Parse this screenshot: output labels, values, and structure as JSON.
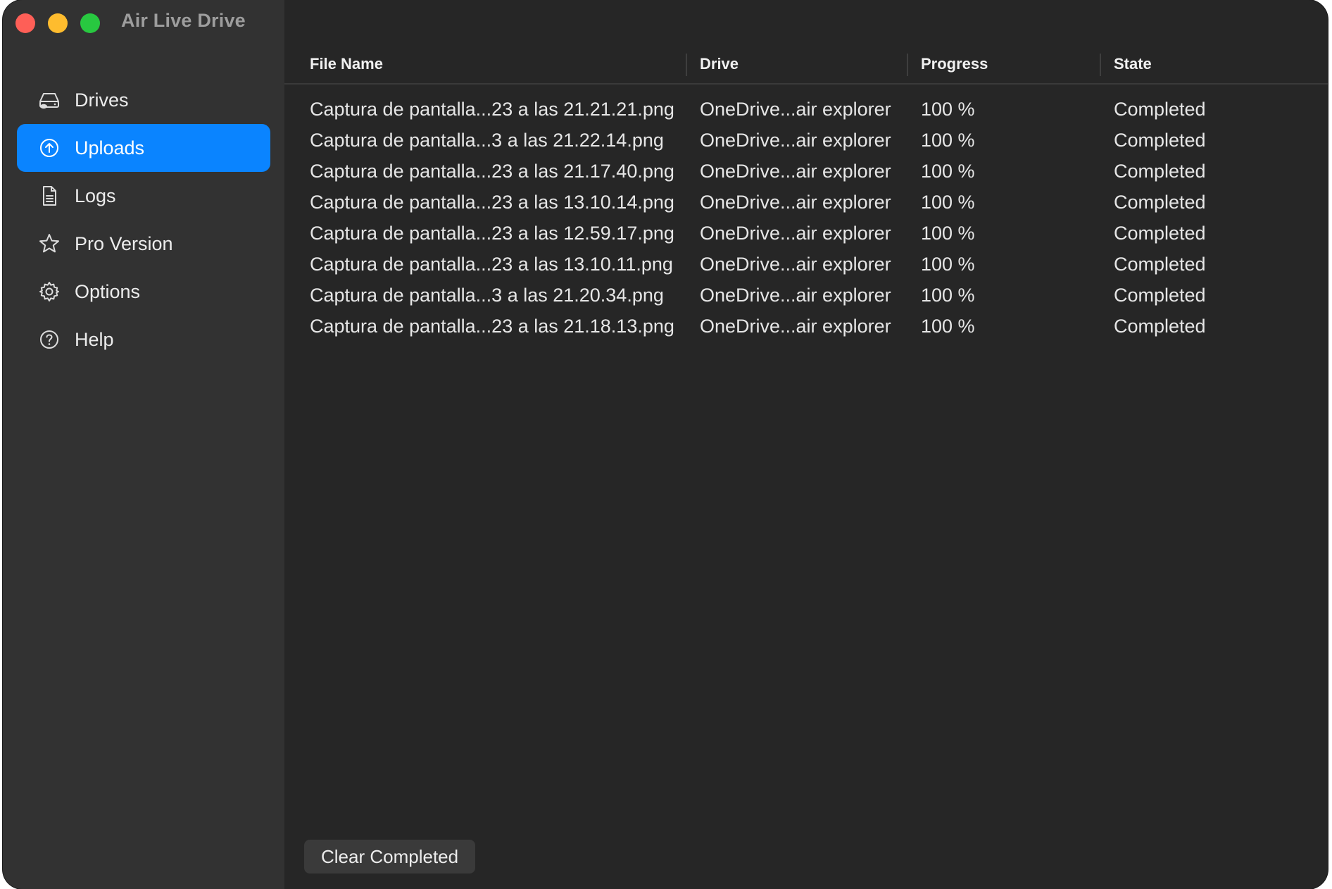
{
  "window": {
    "title": "Air Live Drive"
  },
  "sidebar": {
    "items": [
      {
        "label": "Drives",
        "icon": "drive-icon",
        "active": false
      },
      {
        "label": "Uploads",
        "icon": "upload-icon",
        "active": true
      },
      {
        "label": "Logs",
        "icon": "document-icon",
        "active": false
      },
      {
        "label": "Pro Version",
        "icon": "star-icon",
        "active": false
      },
      {
        "label": "Options",
        "icon": "gear-icon",
        "active": false
      },
      {
        "label": "Help",
        "icon": "help-icon",
        "active": false
      }
    ]
  },
  "table": {
    "headers": {
      "file_name": "File Name",
      "drive": "Drive",
      "progress": "Progress",
      "state": "State"
    },
    "rows": [
      {
        "file": "Captura de pantalla...23 a las 21.21.21.png",
        "drive": "OneDrive...air explorer",
        "progress": "100 %",
        "state": "Completed"
      },
      {
        "file": "Captura de pantalla...3 a las 21.22.14.png",
        "drive": "OneDrive...air explorer",
        "progress": "100 %",
        "state": "Completed"
      },
      {
        "file": "Captura de pantalla...23 a las 21.17.40.png",
        "drive": "OneDrive...air explorer",
        "progress": "100 %",
        "state": "Completed"
      },
      {
        "file": "Captura de pantalla...23 a las 13.10.14.png",
        "drive": "OneDrive...air explorer",
        "progress": "100 %",
        "state": "Completed"
      },
      {
        "file": "Captura de pantalla...23 a las 12.59.17.png",
        "drive": "OneDrive...air explorer",
        "progress": "100 %",
        "state": "Completed"
      },
      {
        "file": "Captura de pantalla...23 a las 13.10.11.png",
        "drive": "OneDrive...air explorer",
        "progress": "100 %",
        "state": "Completed"
      },
      {
        "file": "Captura de pantalla...3 a las 21.20.34.png",
        "drive": "OneDrive...air explorer",
        "progress": "100 %",
        "state": "Completed"
      },
      {
        "file": "Captura de pantalla...23 a las 21.18.13.png",
        "drive": "OneDrive...air explorer",
        "progress": "100 %",
        "state": "Completed"
      }
    ]
  },
  "footer": {
    "clear_label": "Clear Completed"
  },
  "colors": {
    "accent": "#0a84ff",
    "window_bg": "#262626",
    "sidebar_bg": "#323232",
    "close": "#fe5f57",
    "minimize": "#febc2e",
    "maximize": "#28c840"
  }
}
